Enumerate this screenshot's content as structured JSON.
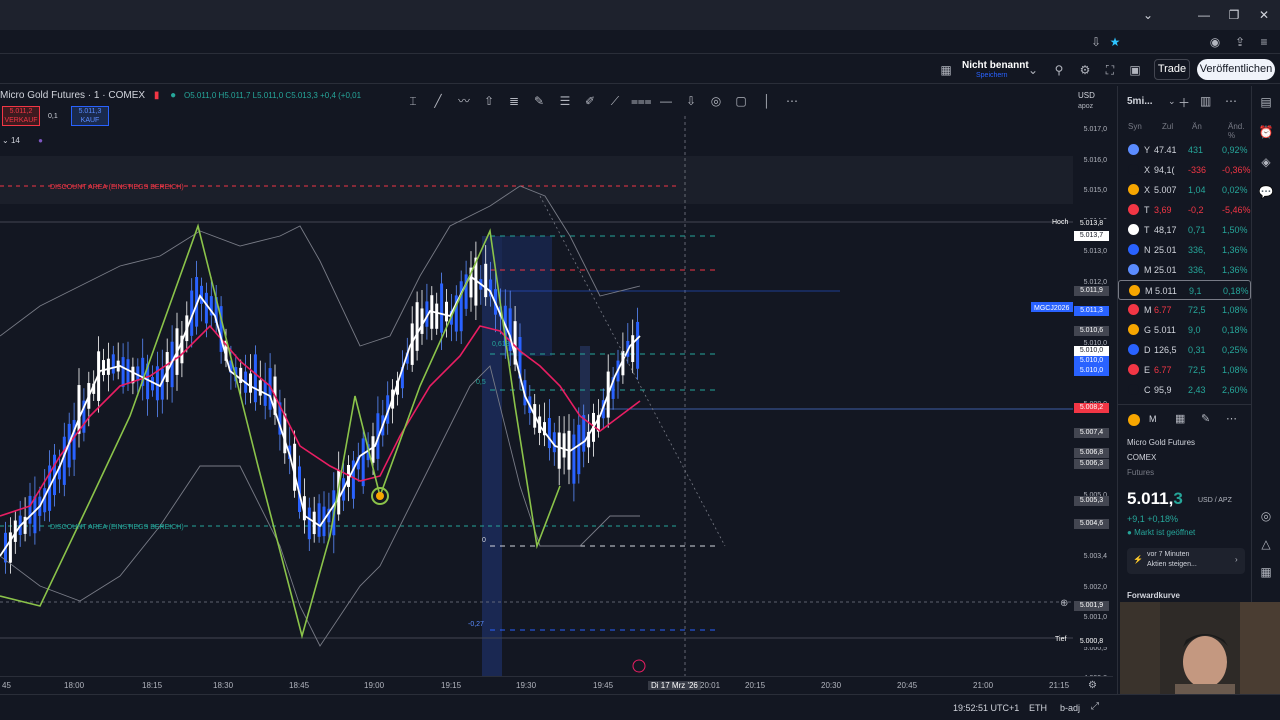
{
  "window": {
    "controls": [
      "chevron-down",
      "minimize",
      "maximize",
      "close"
    ]
  },
  "topbar": {
    "layout_name": "Nicht benannt",
    "layout_sub": "Speichern",
    "trade_label": "Trade",
    "publish_label": "Veröffentlichen"
  },
  "chart": {
    "symbol": "Micro Gold Futures · 1 · COMEX",
    "ohlc": "O5.011,0  H5.011,7  L5.011,0  C5.013,3  +0,4 (+0,01",
    "sell": {
      "price": "5.011,2",
      "label": "VERKAUF"
    },
    "buy": {
      "price": "5.011,3",
      "label": "KAUF"
    },
    "qty": "0,1",
    "indicator_count": "14",
    "annotations": {
      "discount_top": "DISCOUNT AREA (EINSTIEGS BEREICH)",
      "discount_bottom": "DISCOUNT AREA (EINSTIEGS BEREICH)",
      "fib_0618": "0,618",
      "fib_05": "0,5",
      "fib_0": "0",
      "fib_neg": "-0,27",
      "fib_top": "0,5",
      "high_tag": "Hoch",
      "low_tag": "Tief",
      "sym_tag": "MGCJ2026"
    },
    "currency": "USD",
    "unit": "apoz"
  },
  "price_axis": {
    "labels": [
      "5.017,0",
      "5.016,0",
      "5.015,0",
      "5.014,0",
      "5.013,0",
      "5.012,0",
      "5.011,0",
      "5.010,0",
      "5.009,0",
      "5.008,0",
      "5.007,0",
      "5.006,0",
      "5.005,0",
      "5.004,0",
      "5.003,4",
      "5.002,0",
      "5.001,0",
      "5.000,5",
      "4.999,8"
    ],
    "tags": [
      {
        "text": "5.013,8",
        "color": "#131722"
      },
      {
        "text": "5.013,7",
        "color": "#ffffff"
      },
      {
        "text": "5.011,9",
        "color": "#434651"
      },
      {
        "text": "5.011,3",
        "color": "#2962ff"
      },
      {
        "text": "5.010,6",
        "color": "#434651"
      },
      {
        "text": "5.010,0",
        "color": "#ffffff"
      },
      {
        "text": "5.010,0",
        "color": "#2962ff"
      },
      {
        "text": "5.010,0",
        "color": "#2962ff"
      },
      {
        "text": "5.008,2",
        "color": "#f23645"
      },
      {
        "text": "5.007,4",
        "color": "#434651"
      },
      {
        "text": "5.006,8",
        "color": "#434651"
      },
      {
        "text": "5.006,3",
        "color": "#434651"
      },
      {
        "text": "5.005,3",
        "color": "#434651"
      },
      {
        "text": "5.004,6",
        "color": "#434651"
      },
      {
        "text": "5.001,9",
        "color": "#434651"
      },
      {
        "text": "5.000,8",
        "color": "#131722"
      }
    ]
  },
  "time_axis": {
    "labels": [
      "45",
      "18:00",
      "18:15",
      "18:30",
      "18:45",
      "19:00",
      "19:15",
      "19:30",
      "19:45",
      "Di 17 Mrz '26",
      "20:01",
      "20:15",
      "20:30",
      "20:45",
      "21:00",
      "21:15"
    ]
  },
  "watchlist": {
    "title": "5mi...",
    "columns": [
      "Syn",
      "Zul",
      "Än",
      "Änd. %"
    ],
    "rows": [
      {
        "sym": "Y",
        "last": "47.41",
        "chg": "431",
        "pct": "0,92%",
        "dir": "pos",
        "logo": "#5b8cff"
      },
      {
        "sym": "X",
        "last": "94,1(",
        "chg": "-336",
        "pct": "-0,36%",
        "dir": "neg",
        "logo": "#131722"
      },
      {
        "sym": "X",
        "last": "5.007",
        "chg": "1,04",
        "pct": "0,02%",
        "dir": "pos",
        "logo": "#f7a600"
      },
      {
        "sym": "T",
        "last": "3,69",
        "chg": "-0,2",
        "pct": "-5,46%",
        "dir": "neg",
        "logo": "#f23645"
      },
      {
        "sym": "T",
        "last": "48,17",
        "chg": "0,71",
        "pct": "1,50%",
        "dir": "pos",
        "logo": "#ffffff"
      },
      {
        "sym": "N",
        "last": "25.01",
        "chg": "336,",
        "pct": "1,36%",
        "dir": "pos",
        "logo": "#2962ff"
      },
      {
        "sym": "M",
        "last": "25.01",
        "chg": "336,",
        "pct": "1,36%",
        "dir": "pos",
        "logo": "#5b8cff"
      },
      {
        "sym": "M",
        "last": "5.011",
        "chg": "9,1",
        "pct": "0,18%",
        "dir": "pos",
        "logo": "#f7a600"
      },
      {
        "sym": "M",
        "last": "6.77",
        "chg": "72,5",
        "pct": "1,08%",
        "dir": "pos",
        "logo": "#f23645"
      },
      {
        "sym": "G",
        "last": "5.011",
        "chg": "9,0",
        "pct": "0,18%",
        "dir": "pos",
        "logo": "#f7a600"
      },
      {
        "sym": "D",
        "last": "126,5",
        "chg": "0,31",
        "pct": "0,25%",
        "dir": "pos",
        "logo": "#2962ff"
      },
      {
        "sym": "E",
        "last": "6.77",
        "chg": "72,5",
        "pct": "1,08%",
        "dir": "pos",
        "logo": "#f23645"
      },
      {
        "sym": "C",
        "last": "95,9",
        "chg": "2,43",
        "pct": "2,60%",
        "dir": "pos",
        "logo": "#131722"
      }
    ]
  },
  "details": {
    "sym": "M",
    "name": "Micro Gold Futures",
    "exchange": "COMEX",
    "type": "Futures",
    "price_main": "5.011,",
    "price_frac": "3",
    "price_unit": "USD / APZ",
    "change": "+9,1 +0,18%",
    "market_status": "Markt ist geöffnet",
    "news_time": "vor 7 Minuten",
    "news_text": "Aktien steigen...",
    "forward_label": "Forwardkurve"
  },
  "status": {
    "clock": "19:52:51 UTC+1",
    "session": "ETH",
    "adj": "b-adj"
  },
  "colors": {
    "up": "#26a69a",
    "down": "#f23645",
    "accent": "#2962ff",
    "bg": "#131722"
  }
}
